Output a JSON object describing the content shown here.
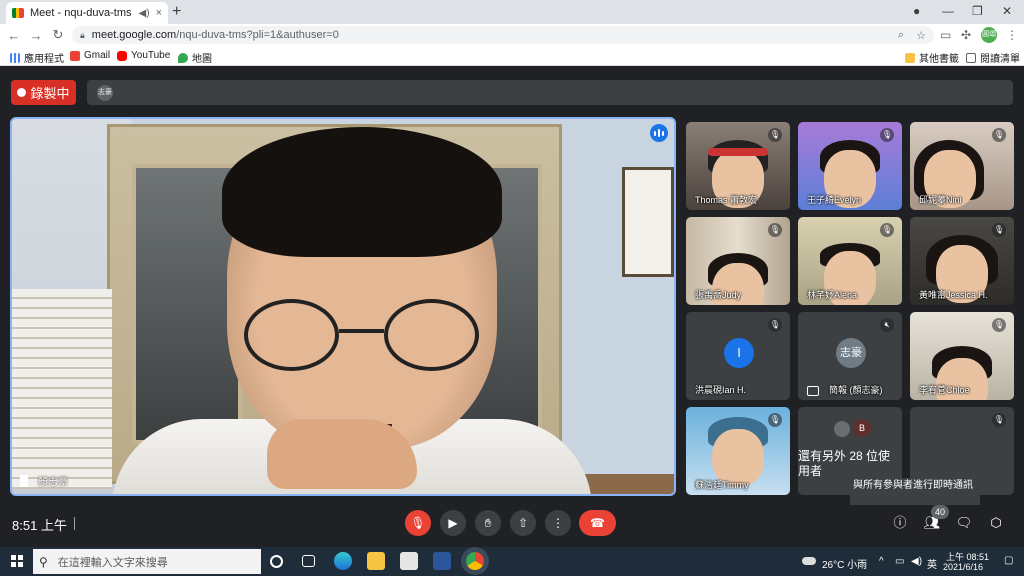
{
  "browser": {
    "tab_title": "Meet - nqu-duva-tms",
    "tab_close": "×",
    "new_tab": "+",
    "url_host": "meet.google.com",
    "url_path": "/nqu-duva-tms?pli=1&authuser=0",
    "profile_initial": "圓頌",
    "bookmarks": [
      "應用程式",
      "Gmail",
      "YouTube",
      "地圖"
    ],
    "bookmarks_right": [
      "其他書籤",
      "閱讀清單"
    ]
  },
  "meet": {
    "recording_label": "錄製中",
    "top_chip": "志豪",
    "main_speaker": "顏志豪",
    "tiles": [
      {
        "name": "Thomas 蕭敦宏",
        "type": "video"
      },
      {
        "name": "王子綺Evelyn",
        "type": "video"
      },
      {
        "name": "邱妮蓁Nini",
        "type": "video"
      },
      {
        "name": "張禹喬Judy",
        "type": "video"
      },
      {
        "name": "林芊妤Alena",
        "type": "video"
      },
      {
        "name": "黃唯甯Jessica H.",
        "type": "video"
      },
      {
        "name": "洪晨硯Ian H.",
        "type": "avatar",
        "initial": "I"
      },
      {
        "name": "簡報 (顏志豪)",
        "type": "avatar",
        "initial": "志豪"
      },
      {
        "name": "李宥菅Chloe",
        "type": "video"
      },
      {
        "name": "蘇浩廷Timmy",
        "type": "video"
      }
    ],
    "others_initial": "B",
    "others_text": "還有另外 28 位使用者",
    "tooltip": "與所有參與者進行即時通訊",
    "time": "8:51 上午",
    "participants_count": "40"
  },
  "taskbar": {
    "search_placeholder": "在這裡輸入文字來搜尋",
    "weather": "26°C 小雨",
    "ime": "英",
    "clock_time": "上午 08:51",
    "clock_date": "2021/6/16"
  },
  "colors": {
    "meet_bg": "#202124",
    "record_red": "#d93025",
    "active_speaker_border": "#8ab4f8",
    "leave_red": "#ea4335",
    "avatar_blue": "#1a73e8"
  }
}
